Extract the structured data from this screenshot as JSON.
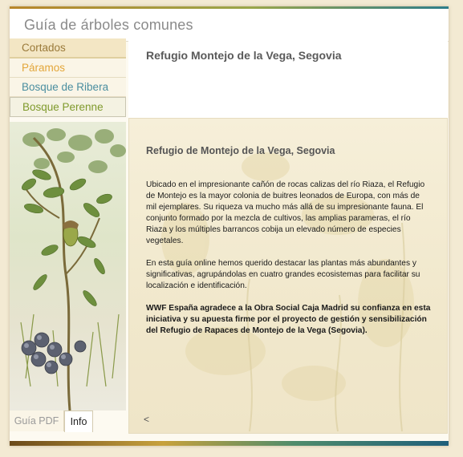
{
  "app": {
    "title": "Guía de árboles comunes"
  },
  "nav": {
    "items": [
      {
        "label": "Cortados",
        "color": "#9a7a3a"
      },
      {
        "label": "Páramos",
        "color": "#e3a63a"
      },
      {
        "label": "Bosque de Ribera",
        "color": "#4a8ea0"
      },
      {
        "label": "Bosque Perenne",
        "color": "#7f9a2c"
      }
    ]
  },
  "page": {
    "title": "Refugio Montejo de la Vega, Segovia"
  },
  "content": {
    "heading": "Refugio de Montejo de la Vega, Segovia",
    "paragraph1": "Ubicado en el impresionante cañón de rocas calizas del río Riaza, el Refugio de Montejo es la mayor colonia de buitres leonados de Europa, con más de mil ejemplares. Su riqueza va mucho más allá de su impresionante fauna. El conjunto formado por la mezcla de cultivos, las amplias parameras, el río Riaza y los múltiples barrancos cobija un elevado número de especies vegetales.",
    "paragraph2": "En esta guía online hemos querido destacar las plantas más abundantes y significativas, agrupándolas en cuatro grandes ecosistemas para facilitar su localización e identificación.",
    "paragraph3": "WWF España agradece a la Obra Social Caja Madrid su confianza en esta iniciativa y su apuesta firme por el proyecto de gestión y sensibilización del Refugio de Rapaces de Montejo de la Vega (Segovia).",
    "prev_label": "<"
  },
  "tabs": {
    "pdf": "Guía PDF",
    "info": "Info"
  },
  "colors": {
    "accent_gold": "#b8862a",
    "accent_teal": "#2e7d8a",
    "panel_bg": "#f3ead3"
  }
}
